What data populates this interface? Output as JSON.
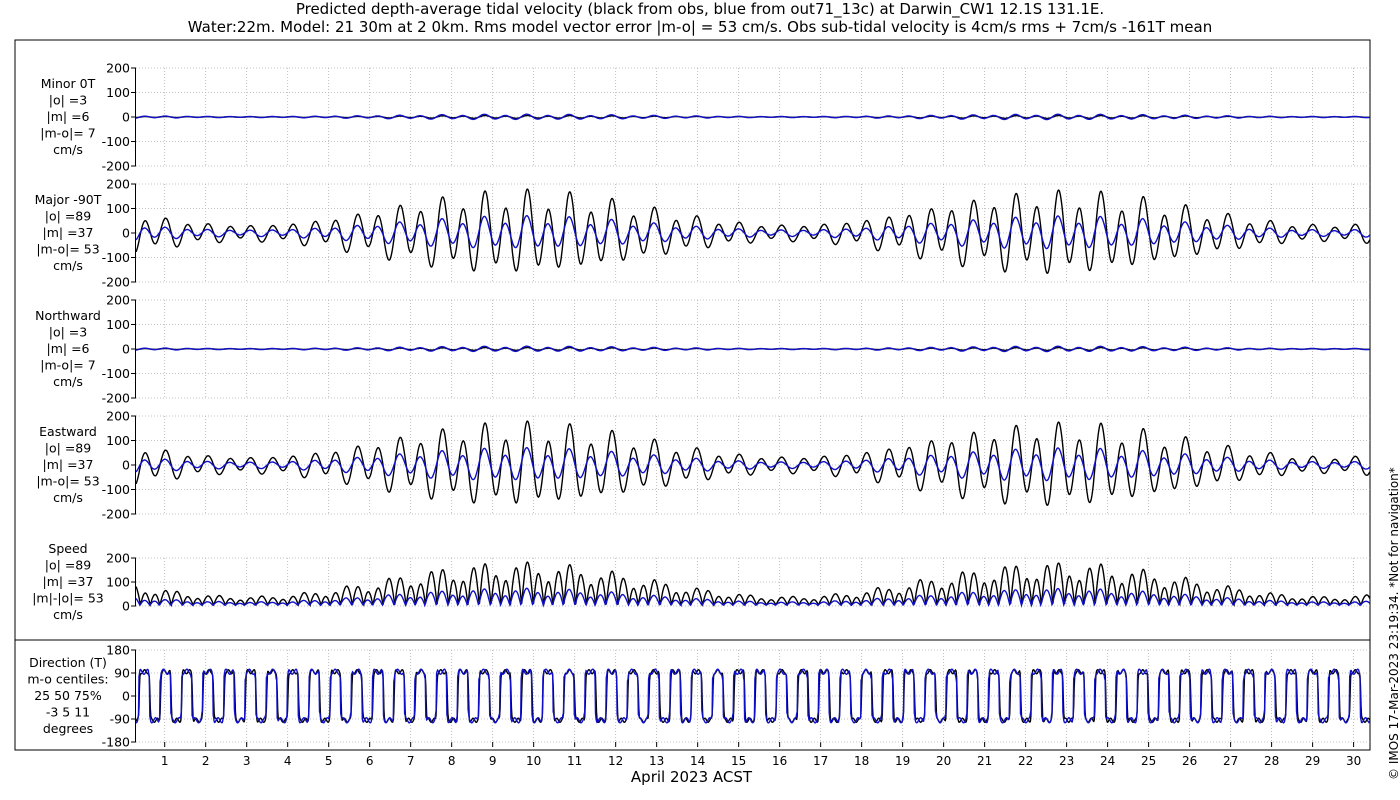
{
  "title_line1": "Predicted depth-average tidal velocity (black from obs, blue from out71_13c) at Darwin_CW1 12.1S 131.1E.",
  "title_line2": "Water:22m. Model: 21 30m at 2 0km. Rms model vector error |m-o| = 53 cm/s. Obs sub-tidal velocity is 4cm/s rms + 7cm/s -161T mean",
  "xlabel": "April 2023 ACST",
  "credit": "© IMOS 17-Mar-2023 23:19:34. *Not for navigation*",
  "colors": {
    "obs": "#000000",
    "model": "#1010c8",
    "grid": "#b0b0b0"
  },
  "chart_data": {
    "type": "line",
    "x_ticks": [
      "1",
      "2",
      "3",
      "4",
      "5",
      "6",
      "7",
      "8",
      "9",
      "10",
      "11",
      "12",
      "13",
      "14",
      "15",
      "16",
      "17",
      "18",
      "19",
      "20",
      "21",
      "22",
      "23",
      "24",
      "25",
      "26",
      "27",
      "28",
      "29",
      "30"
    ],
    "x_unit": "day of April 2023",
    "xlim": [
      0.3,
      30.4
    ],
    "series_names": [
      "obs (black)",
      "model out71_13c (blue)"
    ],
    "panels": [
      {
        "id": "minor",
        "label": [
          "Minor 0T",
          "|o| =3",
          "|m| =6",
          "|m-o|= 7",
          "cm/s"
        ],
        "yticks": [
          "200",
          "100",
          "0",
          "-100",
          "-200"
        ],
        "ylim": [
          -200,
          200
        ],
        "obs_amp": 3,
        "model_amp": 6,
        "style": "tidal"
      },
      {
        "id": "major",
        "label": [
          "Major -90T",
          "|o| =89",
          "|m| =37",
          "|m-o|= 53",
          "cm/s"
        ],
        "yticks": [
          "200",
          "100",
          "0",
          "-100",
          "-200"
        ],
        "ylim": [
          -200,
          200
        ],
        "obs_amp": 89,
        "model_amp": 37,
        "style": "tidal"
      },
      {
        "id": "north",
        "label": [
          "Northward",
          "|o| =3",
          "|m| =6",
          "|m-o|= 7",
          "cm/s"
        ],
        "yticks": [
          "200",
          "100",
          "0",
          "-100",
          "-200"
        ],
        "ylim": [
          -200,
          200
        ],
        "obs_amp": 3,
        "model_amp": 6,
        "style": "tidal"
      },
      {
        "id": "east",
        "label": [
          "Eastward",
          "|o| =89",
          "|m| =37",
          "|m-o|= 53",
          "cm/s"
        ],
        "yticks": [
          "200",
          "100",
          "0",
          "-100",
          "-200"
        ],
        "ylim": [
          -200,
          200
        ],
        "obs_amp": 89,
        "model_amp": 37,
        "style": "tidal"
      },
      {
        "id": "speed",
        "label": [
          "Speed",
          "|o| =89",
          "|m| =37",
          "|m|-|o|= 53",
          "cm/s"
        ],
        "yticks": [
          "200",
          "100",
          "0"
        ],
        "ylim": [
          0,
          200
        ],
        "obs_amp": 89,
        "model_amp": 37,
        "style": "speed"
      },
      {
        "id": "direction",
        "label": [
          "Direction (T)",
          "m-o centiles:",
          "25  50  75%",
          "-3   5  11",
          "degrees"
        ],
        "yticks": [
          "180",
          "90",
          "0",
          "-90",
          "-180"
        ],
        "ylim": [
          -180,
          180
        ],
        "style": "direction"
      }
    ]
  }
}
